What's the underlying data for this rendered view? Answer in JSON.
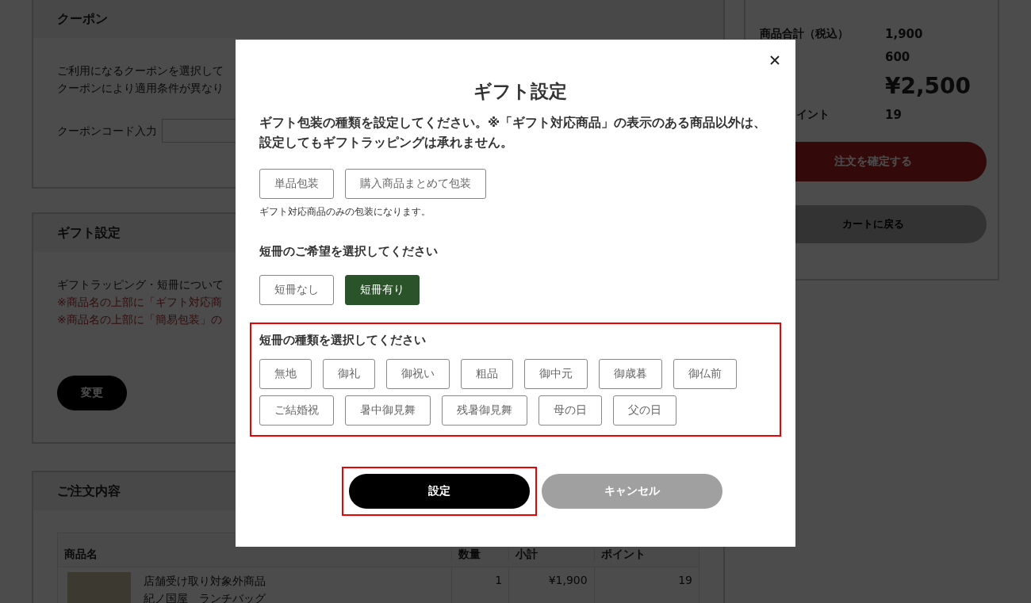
{
  "coupon": {
    "title": "クーポン",
    "lines": [
      "ご利用になるクーポンを選択して",
      "クーポンにより適用条件が異なり"
    ],
    "code_label": "クーポンコード入力"
  },
  "gift": {
    "title": "ギフト設定",
    "text": "ギフトラッピング・短冊について",
    "notes": [
      "※商品名の上部に「ギフト対応商",
      "※商品名の上部に「簡易包装」の"
    ],
    "button": "変更"
  },
  "order": {
    "title": "ご注文内容",
    "columns": [
      "商品名",
      "数量",
      "小計",
      "ポイント"
    ],
    "rows": [
      {
        "lines": [
          "店舗受け取り対象外商品",
          "紀ノ国屋　ランチバッグ"
        ],
        "quantity": "1",
        "subtotal": "¥1,900",
        "points": "19"
      }
    ]
  },
  "summary": {
    "rows": [
      {
        "label": "商品合計（税込）",
        "value": "1,900",
        "kind": "plain"
      },
      {
        "label": "",
        "value": "600",
        "kind": "plain"
      },
      {
        "label": "",
        "value": "¥2,500",
        "kind": "total"
      },
      {
        "label": "イント",
        "value": "19",
        "kind": "partial"
      }
    ],
    "confirm_button": "注文を確定する",
    "back_button": "カートに戻る"
  },
  "modal": {
    "title": "ギフト設定",
    "description": "ギフト包装の種類を設定してください。※「ギフト対応商品」の表示のある商品以外は、設定してもギフトラッピングは承れません。",
    "wrap_options": [
      {
        "label": "単品包装",
        "selected": false
      },
      {
        "label": "購入商品まとめて包装",
        "selected": false
      }
    ],
    "wrap_note": "ギフト対応商品のみの包装になります。",
    "tanzaku_heading": "短冊のご希望を選択してください",
    "tanzaku_options": [
      {
        "label": "短冊なし",
        "selected": false
      },
      {
        "label": "短冊有り",
        "selected": true
      }
    ],
    "type_heading": "短冊の種類を選択してください",
    "type_highlighted": true,
    "type_options": [
      {
        "label": "無地",
        "selected": false
      },
      {
        "label": "御礼",
        "selected": false
      },
      {
        "label": "御祝い",
        "selected": false
      },
      {
        "label": "粗品",
        "selected": false
      },
      {
        "label": "御中元",
        "selected": false
      },
      {
        "label": "御歳暮",
        "selected": false
      },
      {
        "label": "御仏前",
        "selected": false
      },
      {
        "label": "ご結婚祝",
        "selected": false
      },
      {
        "label": "暑中御見舞",
        "selected": false
      },
      {
        "label": "残暑御見舞",
        "selected": false
      },
      {
        "label": "母の日",
        "selected": false
      },
      {
        "label": "父の日",
        "selected": false
      }
    ],
    "ok_button": "設定",
    "ok_highlighted": true,
    "cancel_button": "キャンセル"
  }
}
